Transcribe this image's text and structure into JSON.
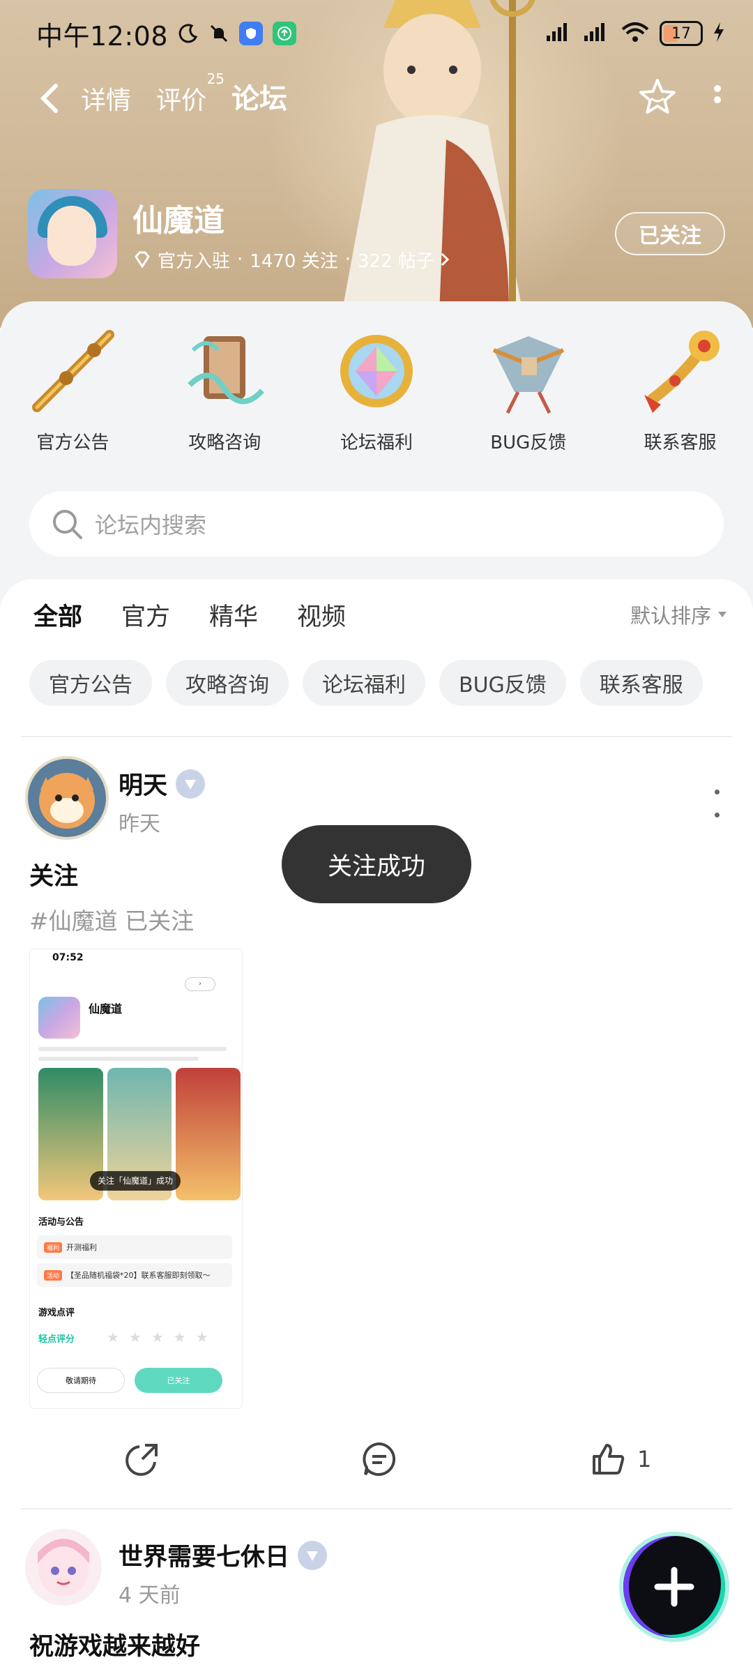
{
  "status_bar": {
    "time": "中午12:08",
    "battery": "17"
  },
  "nav": {
    "tabs": [
      {
        "label": "详情",
        "badge": ""
      },
      {
        "label": "评价",
        "badge": "25"
      },
      {
        "label": "论坛",
        "badge": ""
      }
    ],
    "active_tab": "论坛"
  },
  "game": {
    "name": "仙魔道",
    "official": "官方入驻",
    "followers": "1470 关注",
    "posts": "322 帖子",
    "follow_button": "已关注"
  },
  "categories": [
    {
      "label": "官方公告",
      "icon": "staff-icon"
    },
    {
      "label": "攻略咨询",
      "icon": "scroll-icon"
    },
    {
      "label": "论坛福利",
      "icon": "gem-icon"
    },
    {
      "label": "BUG反馈",
      "icon": "kite-icon"
    },
    {
      "label": "联系客服",
      "icon": "ruyi-icon"
    }
  ],
  "search": {
    "placeholder": "论坛内搜索"
  },
  "feed": {
    "tabs": [
      "全部",
      "官方",
      "精华",
      "视频"
    ],
    "active_tab": "全部",
    "sort": "默认排序",
    "filters": [
      "官方公告",
      "攻略咨询",
      "论坛福利",
      "BUG反馈",
      "联系客服"
    ]
  },
  "posts": [
    {
      "user": "明天",
      "time": "昨天",
      "title": "关注",
      "tag": "#仙魔道 已关注",
      "likes": "1",
      "screenshot": {
        "time": "07:52",
        "name": "仙魔道",
        "toast": "关注「仙魔道」成功",
        "section_events": "活动与公告",
        "row1_tag": "福利",
        "row1": "开测福利",
        "row2_tag": "活动",
        "row2": "【圣品随机福袋*20】联系客服即刻领取～",
        "section_reviews": "游戏点评",
        "rating_label": "轻点评分",
        "btn_left": "敬请期待",
        "btn_right": "已关注"
      }
    },
    {
      "user": "世界需要七休日",
      "time": "4 天前",
      "title": "祝游戏越来越好"
    }
  ],
  "toast": "关注成功",
  "colors": {
    "accent": "#18d6b2",
    "toast_bg": "#333333"
  }
}
